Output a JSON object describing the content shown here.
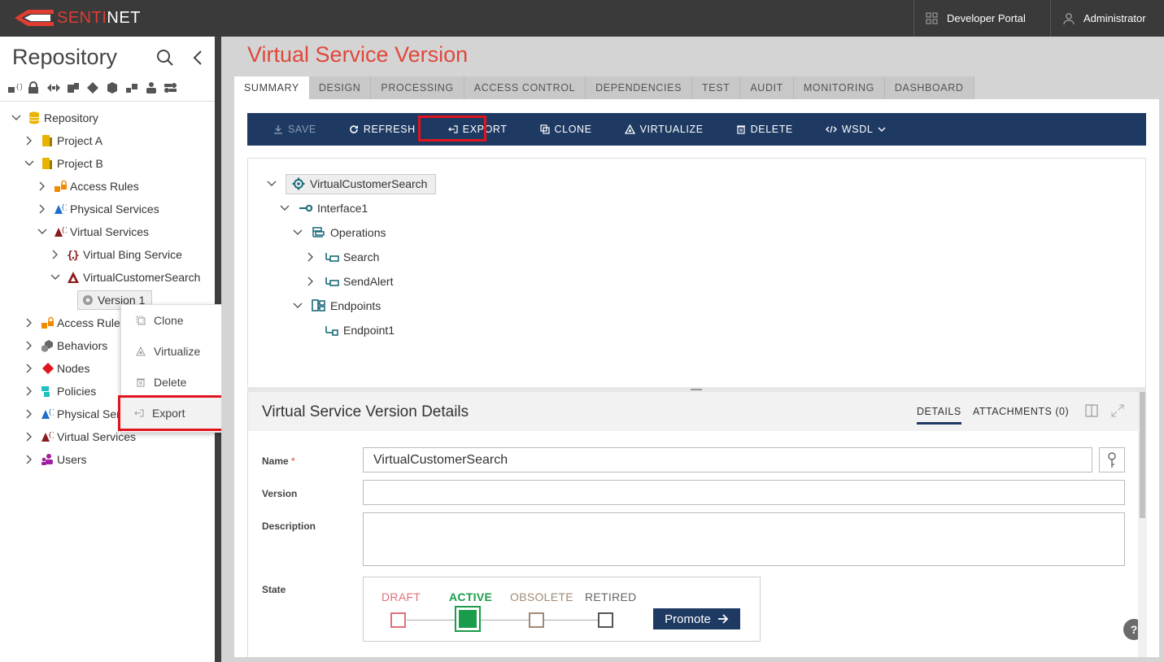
{
  "brand": {
    "name_prefix": "SENTI",
    "name_suffix": "NET"
  },
  "topbar": {
    "developer_portal": "Developer Portal",
    "user": "Administrator"
  },
  "sidebar": {
    "title": "Repository",
    "type_icons": [
      "access-rules-icon",
      "lock-icon",
      "endpoint-icon",
      "project-icon",
      "node-icon",
      "behavior-icon",
      "service-icon",
      "users-icon",
      "policies-icon"
    ],
    "tree": {
      "root": "Repository",
      "project_a": "Project A",
      "project_b": "Project B",
      "access_rules": "Access Rules",
      "physical_services": "Physical Services",
      "virtual_services": "Virtual Services",
      "virtual_bing": "Virtual Bing Service",
      "virtual_customer_search": "VirtualCustomerSearch",
      "version1": "Version 1",
      "root_access_rules": "Access Rules",
      "behaviors": "Behaviors",
      "nodes": "Nodes",
      "policies": "Policies",
      "root_physical_services": "Physical Ser",
      "root_virtual_services": "Virtual Services",
      "users": "Users"
    },
    "context_menu": {
      "clone": "Clone",
      "virtualize": "Virtualize",
      "delete": "Delete",
      "export": "Export"
    }
  },
  "main": {
    "page_title": "Virtual Service Version",
    "tabs": [
      "SUMMARY",
      "DESIGN",
      "PROCESSING",
      "ACCESS CONTROL",
      "DEPENDENCIES",
      "TEST",
      "AUDIT",
      "MONITORING",
      "DASHBOARD"
    ],
    "toolbar": {
      "save": "SAVE",
      "refresh": "REFRESH",
      "export": "EXPORT",
      "clone": "CLONE",
      "virtualize": "VIRTUALIZE",
      "delete": "DELETE",
      "wsdl": "WSDL"
    },
    "structure": {
      "root": "VirtualCustomerSearch",
      "interface": "Interface1",
      "operations": "Operations",
      "search": "Search",
      "send_alert": "SendAlert",
      "endpoints": "Endpoints",
      "endpoint1": "Endpoint1"
    },
    "details": {
      "title": "Virtual Service Version Details",
      "tab_details": "DETAILS",
      "tab_attachments": "ATTACHMENTS (0)",
      "name_label": "Name",
      "name_required": "*",
      "name_value": "VirtualCustomerSearch",
      "version_label": "Version",
      "version_value": "",
      "description_label": "Description",
      "description_value": "",
      "state_label": "State",
      "states": {
        "draft": "DRAFT",
        "active": "ACTIVE",
        "obsolete": "OBSOLETE",
        "retired": "RETIRED"
      },
      "current_state": "ACTIVE",
      "promote": "Promote",
      "help": "?"
    }
  },
  "colors": {
    "accent_red": "#e0483c",
    "navy": "#1e3a63",
    "active_green": "#1a9c4a",
    "highlight_red": "#e0141e"
  }
}
